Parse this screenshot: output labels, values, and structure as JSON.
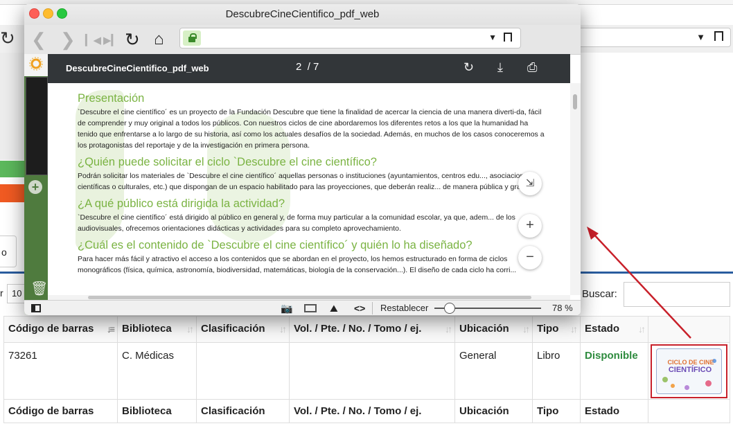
{
  "window": {
    "title": "DescubreCineCientifico_pdf_web",
    "pdf_toolbar": {
      "filename": "DescubreCineCientifico_pdf_web",
      "page_current": "2",
      "page_total": "/ 7"
    },
    "content": {
      "sections": [
        {
          "heading": "Presentación",
          "body": "`Descubre el cine científico´ es un proyecto de la Fundación Descubre que tiene la finalidad de acercar la ciencia de una manera diverti-da, fácil de comprender y muy original a todos los públicos. Con nuestros ciclos de cine abordaremos los diferentes retos a los que la humanidad ha tenido que enfrentarse a lo largo de su historia, así como los actuales desafíos de la sociedad. Además, en muchos de los casos conoceremos a los protagonistas del reportaje y de la investigación en primera persona."
        },
        {
          "heading": "¿Quién puede solicitar el ciclo `Descubre el cine científico?",
          "body": "Podrán solicitar los materiales de `Descubre el cine científico´ aquellas personas o instituciones (ayuntamientos, centros edu..., asociaciones científicas o culturales, etc.) que dispongan de un espacio habilitado para las proyecciones, que deberán realiz... de manera pública y gratuita."
        },
        {
          "heading": "¿A qué público está dirigida la actividad?",
          "body": "`Descubre el cine científico´ está dirigido al público en general y, de forma muy particular a la comunidad escolar, ya que, adem... de los audiovisuales, ofrecemos orientaciones didácticas y actividades para su completo aprovechamiento."
        },
        {
          "heading": "¿Cuál es el contenido de `Descubre el cine científico´ y quién lo ha diseñado?",
          "body": "Para hacer más fácil y atractivo el acceso a los contenidos que se abordan en el proyecto, los hemos estructurado en forma de ciclos monográficos (física, química, astronomía, biodiversidad, matemáticas, biología de la conservación...). El diseño de cada ciclo ha corri..."
        }
      ]
    },
    "bottom_bar": {
      "reset_label": "Restablecer",
      "zoom": "78 %",
      "zoom_fraction": 0.78
    }
  },
  "page": {
    "length_value": "10",
    "left_label": "r",
    "tab_label": "o",
    "search_label": "Buscar:",
    "search_value": "",
    "table": {
      "headers": [
        "Código de barras",
        "Biblioteca",
        "Clasificación",
        "Vol. / Pte. / No. / Tomo / ej.",
        "Ubicación",
        "Tipo",
        "Estado",
        ""
      ],
      "rows": [
        {
          "barcode": "73261",
          "library": "C. Médicas",
          "classification": "",
          "volume": "",
          "location": "General",
          "type": "Libro",
          "status": "Disponible"
        }
      ],
      "footer": [
        "Código de barras",
        "Biblioteca",
        "Clasificación",
        "Vol. / Pte. / No. / Tomo / ej.",
        "Ubicación",
        "Tipo",
        "Estado",
        ""
      ]
    },
    "cover": {
      "line1": "CICLO DE CINE",
      "line2": "CIENTÍFICO"
    }
  },
  "colors": {
    "accent_green": "#7ab342",
    "sidebar_green": "#4f7b3e",
    "status_available": "#2e8b3e",
    "highlight_red": "#c8202a"
  }
}
